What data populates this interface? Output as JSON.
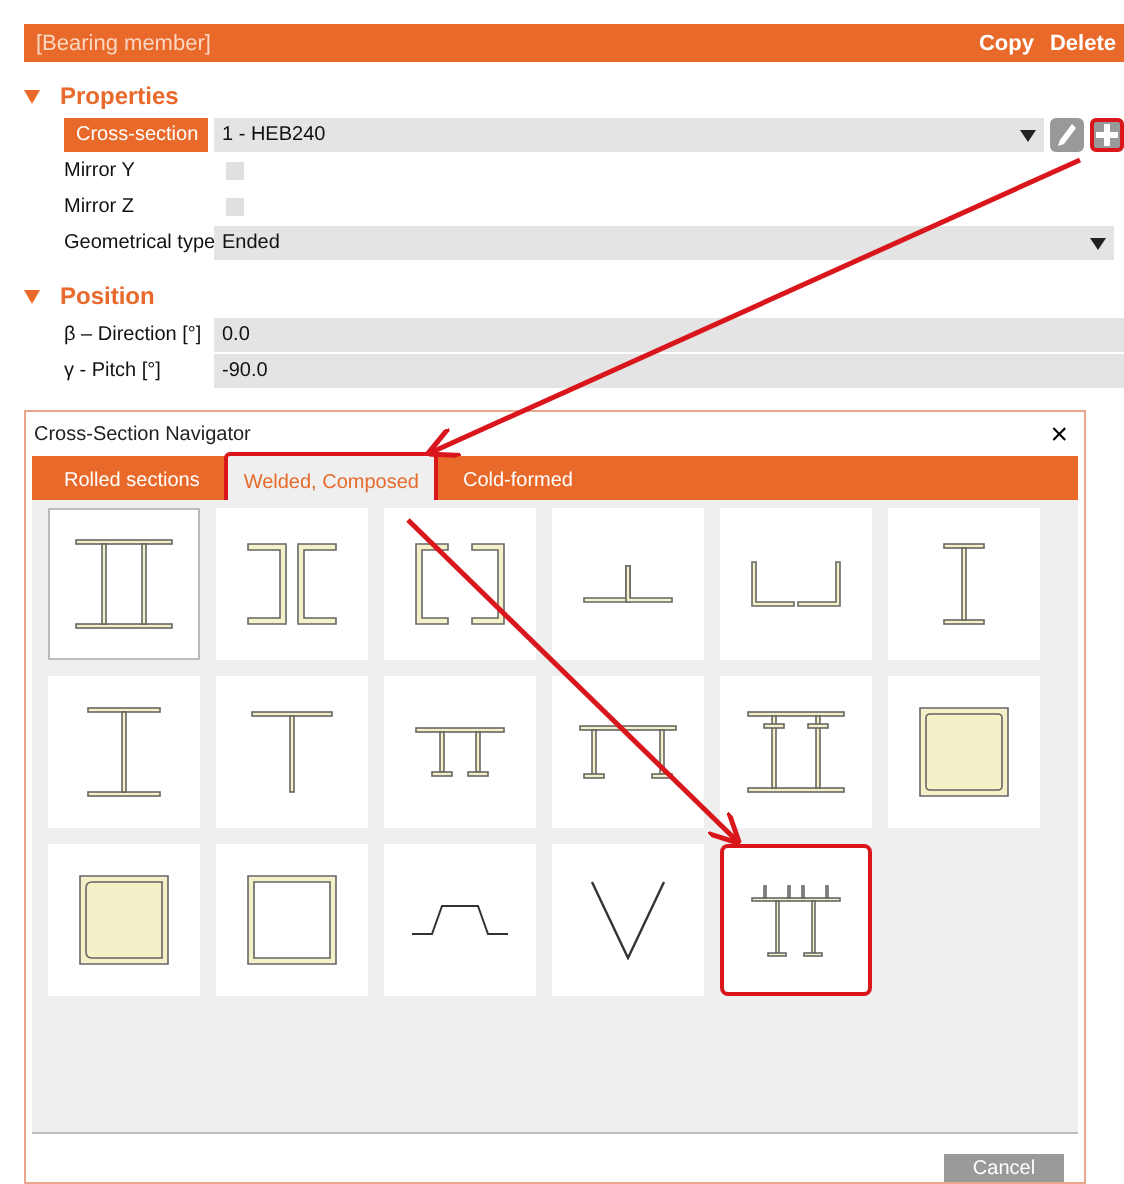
{
  "panel": {
    "title": "[Bearing member]",
    "actions": [
      "Copy",
      "Delete"
    ],
    "sections": [
      {
        "title": "Properties",
        "expanded": true,
        "rows": [
          {
            "kind": "select",
            "label": "Cross-section",
            "value": "1 - HEB240",
            "selected": true,
            "tools": true,
            "highlighted": true
          },
          {
            "kind": "checkbox",
            "label": "Mirror Y",
            "checked": false,
            "selected": false
          },
          {
            "kind": "checkbox",
            "label": "Mirror Z",
            "checked": false,
            "selected": false
          },
          {
            "kind": "select",
            "label": "Geometrical type",
            "value": "Ended",
            "selected": false
          }
        ]
      },
      {
        "title": "Position",
        "expanded": true,
        "rows": [
          {
            "kind": "text",
            "label": "β – Direction [°]",
            "value": "0.0",
            "selected": false
          },
          {
            "kind": "text",
            "label": "γ - Pitch [°]",
            "value": "-90.0",
            "selected": false
          }
        ]
      }
    ]
  },
  "dialog": {
    "title": "Cross-Section Navigator",
    "close": "×",
    "tabs": [
      {
        "label": "Rolled sections",
        "selected": false,
        "highlighted": false
      },
      {
        "label": "Welded, Composed",
        "selected": true,
        "highlighted": true
      },
      {
        "label": "Cold-formed",
        "selected": false,
        "highlighted": false
      }
    ],
    "tiles": [
      {
        "kind": "double-i",
        "selected": true,
        "highlighted": false
      },
      {
        "kind": "back-channels",
        "selected": false,
        "highlighted": false
      },
      {
        "kind": "box-channels",
        "selected": false,
        "highlighted": false
      },
      {
        "kind": "angles-t",
        "selected": false,
        "highlighted": false
      },
      {
        "kind": "angles-u",
        "selected": false,
        "highlighted": false
      },
      {
        "kind": "i-narrow",
        "selected": false,
        "highlighted": false
      },
      {
        "kind": "i-wide",
        "selected": false,
        "highlighted": false
      },
      {
        "kind": "t",
        "selected": false,
        "highlighted": false
      },
      {
        "kind": "i-plate",
        "selected": false,
        "highlighted": false
      },
      {
        "kind": "i-plate-wide",
        "selected": false,
        "highlighted": false
      },
      {
        "kind": "double-i-wide",
        "selected": false,
        "highlighted": false
      },
      {
        "kind": "box-channels-round",
        "selected": false,
        "highlighted": false
      },
      {
        "kind": "box-round",
        "selected": false,
        "highlighted": false
      },
      {
        "kind": "box-square",
        "selected": false,
        "highlighted": false
      },
      {
        "kind": "trapezoid",
        "selected": false,
        "highlighted": false
      },
      {
        "kind": "triangle",
        "selected": false,
        "highlighted": false
      },
      {
        "kind": "i-stiffened",
        "selected": false,
        "highlighted": true
      }
    ],
    "buttons": [
      "Cancel"
    ]
  }
}
